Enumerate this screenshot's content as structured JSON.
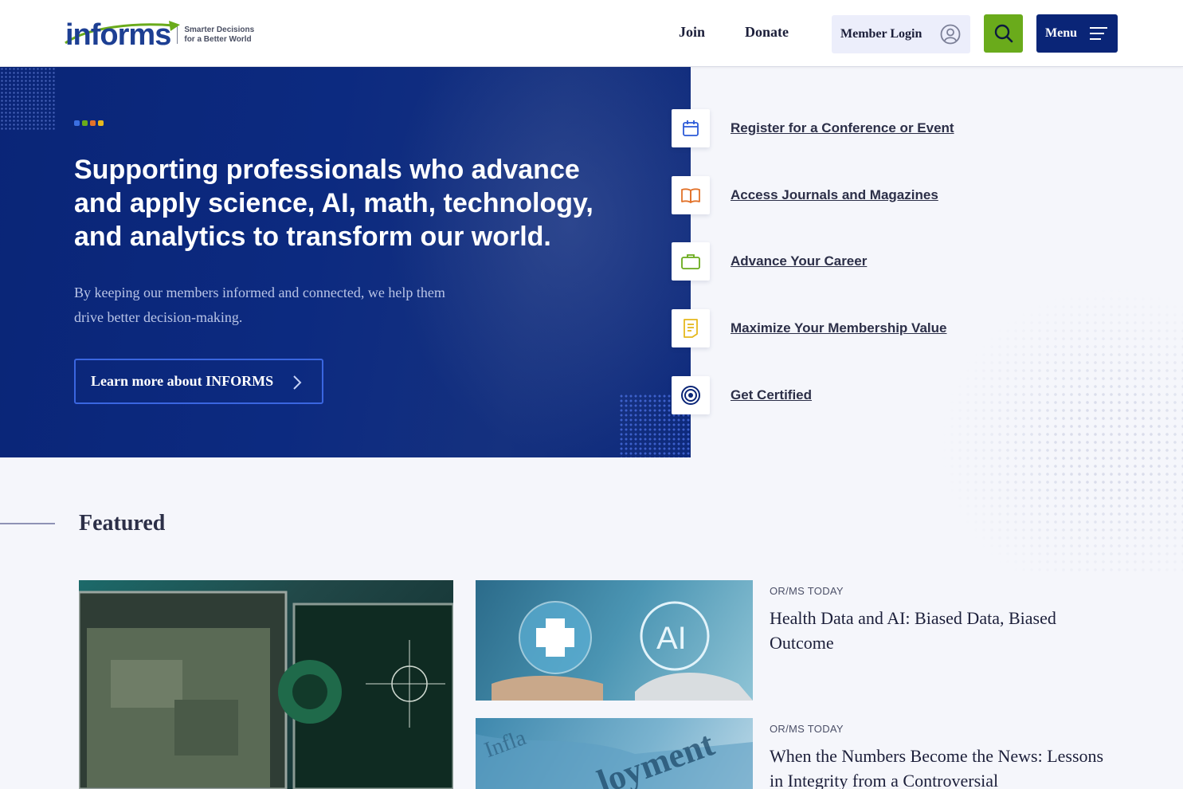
{
  "header": {
    "logo_text": "informs",
    "logo_tagline_1": "Smarter Decisions",
    "logo_tagline_2": "for a Better World",
    "nav_join": "Join",
    "nav_donate": "Donate",
    "login_label": "Member Login",
    "menu_label": "Menu",
    "colors": {
      "search_bg": "#6aab1b",
      "menu_bg": "#0a2577",
      "login_bg": "#eceefb"
    }
  },
  "hero": {
    "title": "Supporting professionals who advance and apply science, AI, math, technology, and analytics to transform our world.",
    "subtitle": "By keeping our members informed and connected, we help them drive better decision-making.",
    "cta_label": "Learn more about INFORMS",
    "dot_colors": [
      "#3b6fe0",
      "#6aab1b",
      "#e2722a",
      "#e5b81d"
    ],
    "background": "#0a2577"
  },
  "quick_links": [
    {
      "label": "Register for a Conference or Event",
      "icon": "calendar-icon",
      "color": "#2b5ad8"
    },
    {
      "label": "Access Journals and Magazines",
      "icon": "book-open-icon",
      "color": "#e2722a"
    },
    {
      "label": "Advance Your Career",
      "icon": "briefcase-icon",
      "color": "#6aab1b"
    },
    {
      "label": "Maximize Your Membership Value",
      "icon": "document-icon",
      "color": "#e5b81d"
    },
    {
      "label": "Get Certified",
      "icon": "target-icon",
      "color": "#0a2577"
    }
  ],
  "featured": {
    "heading": "Featured",
    "articles": [
      {
        "category": "OR/MS TODAY",
        "title": "Health Data and AI: Biased Data, Biased Outcome"
      },
      {
        "category": "OR/MS TODAY",
        "title": "When the Numbers Become the News: Lessons in Integrity from a Controversial"
      }
    ]
  }
}
